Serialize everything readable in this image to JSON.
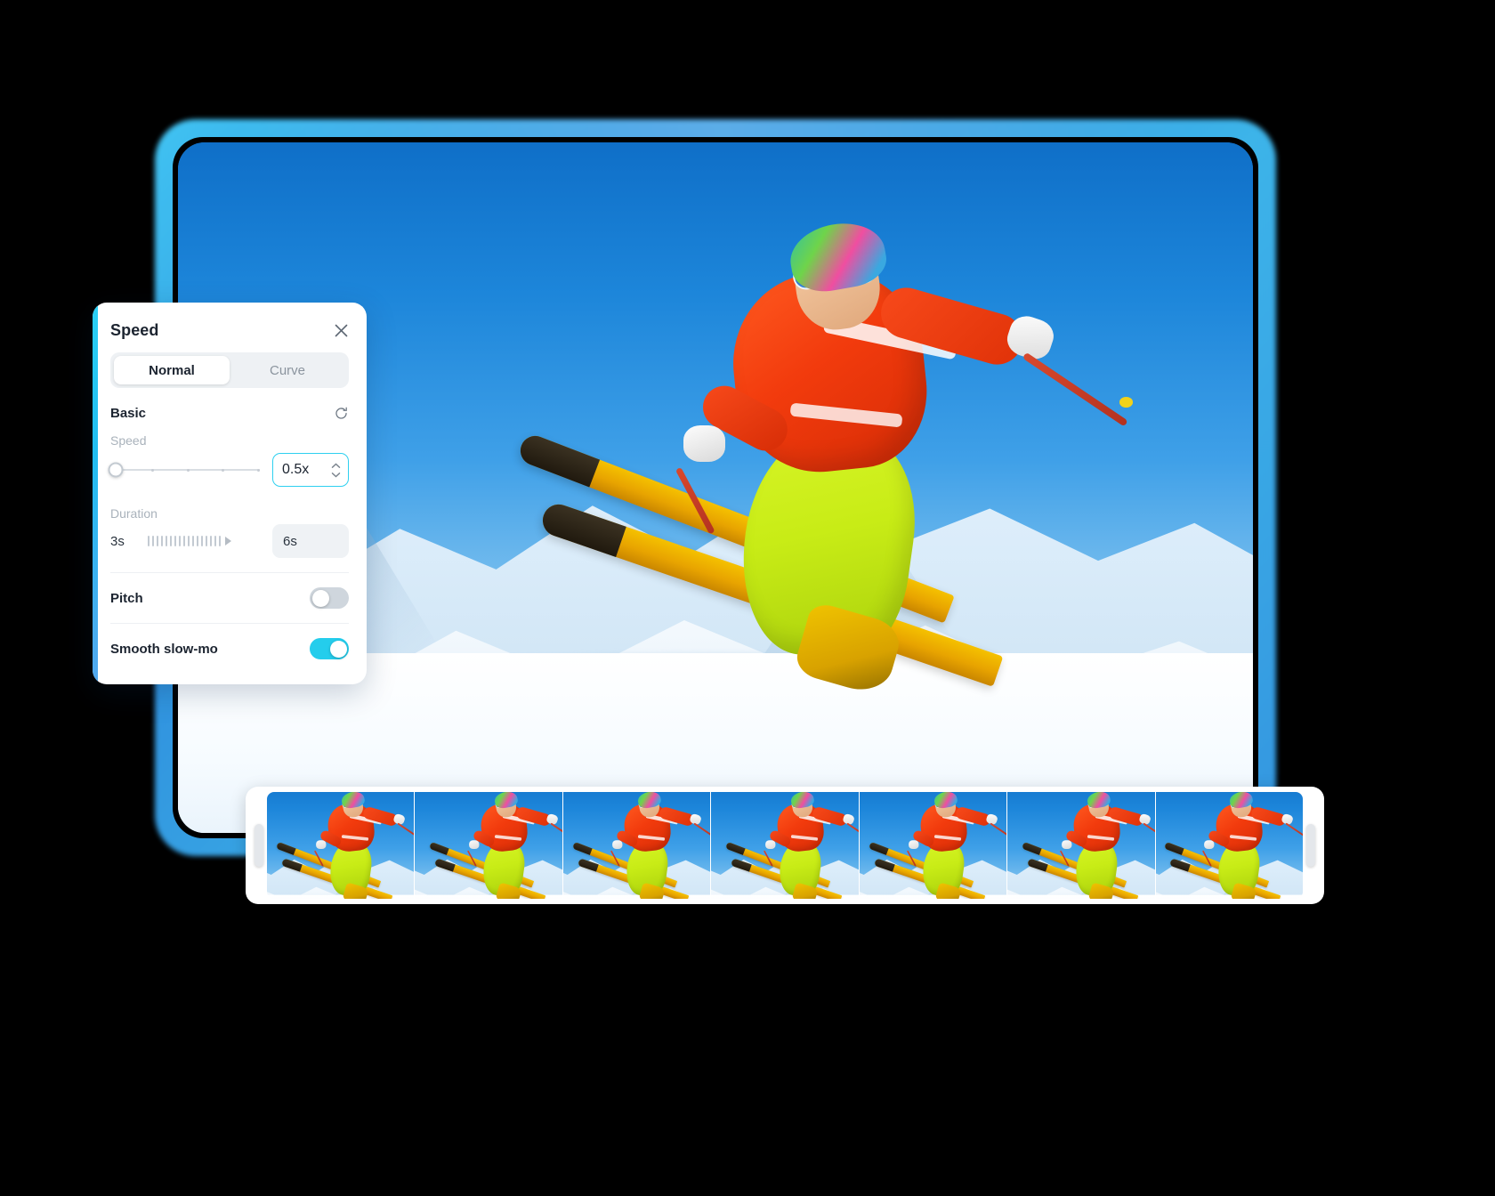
{
  "app": {
    "scene_description": "Skier in orange jacket and yellow pants mid-air jump over snowy mountains"
  },
  "speed_panel": {
    "title": "Speed",
    "close_icon": "close-icon",
    "tabs": [
      {
        "label": "Normal",
        "active": true
      },
      {
        "label": "Curve",
        "active": false
      }
    ],
    "basic": {
      "section_label": "Basic",
      "reset_icon": "reset-icon",
      "speed": {
        "label": "Speed",
        "value": "0.5x",
        "slider_position_percent": 0,
        "tick_count": 5,
        "stepper_up_icon": "chevron-up-icon",
        "stepper_down_icon": "chevron-down-icon",
        "field_accent_color": "#2ed0f0"
      },
      "duration": {
        "label": "Duration",
        "min_value": "3s",
        "current_value": "6s",
        "tick_count": 17,
        "arrow_icon": "play-arrow-icon"
      }
    },
    "options": [
      {
        "label": "Pitch",
        "enabled": false
      },
      {
        "label": "Smooth slow-mo",
        "enabled": true
      }
    ],
    "colors": {
      "accent": "#24cdec",
      "panel_bg": "#ffffff",
      "title_text": "#1c2430",
      "muted_text": "#a9b2bb",
      "track": "#d9dee3"
    }
  },
  "preview": {
    "glow_color": "#1f93ea",
    "selected": true
  },
  "filmstrip": {
    "thumbnail_count": 7,
    "left_handle": "trim-handle-left",
    "right_handle": "trim-handle-right"
  }
}
